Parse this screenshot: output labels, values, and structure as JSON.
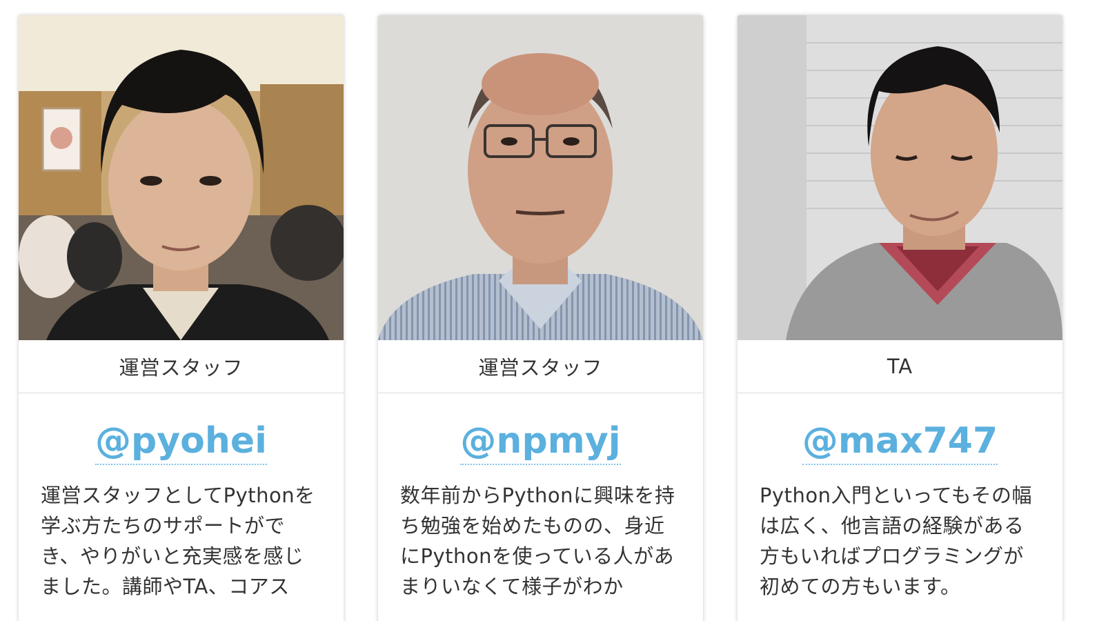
{
  "members": [
    {
      "role": "運営スタッフ",
      "handle": "@pyohei",
      "description": "運営スタッフとしてPythonを学ぶ方たちのサポートができ、やりがいと充実感を感じました。講師やTA、コアス"
    },
    {
      "role": "運営スタッフ",
      "handle": "@npmyj",
      "description": "数年前からPythonに興味を持ち勉強を始めたものの、身近にPythonを使っている人があまりいなくて様子がわか"
    },
    {
      "role": "TA",
      "handle": "@max747",
      "description": "Python入門といってもその幅は広く、他言語の経験がある方もいればプログラミングが初めての方もいます。"
    }
  ],
  "colors": {
    "link": "#5bb0de",
    "text": "#333333",
    "divider": "#dddddd"
  }
}
